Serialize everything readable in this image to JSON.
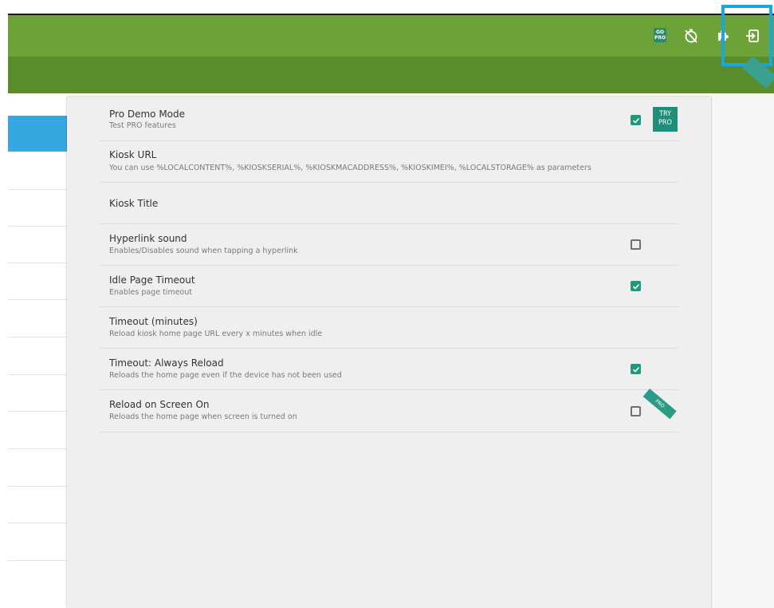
{
  "toolbar": {
    "gopro_icon": "go-pro-icon",
    "gopro_top": "GO",
    "gopro_bottom": "PRO",
    "timer_icon": "timer-off-icon",
    "extension_icon": "puzzle-icon",
    "exit_icon": "exit-icon",
    "bg": "#6da238",
    "subbar_bg": "#588c2d"
  },
  "settings": [
    {
      "title": "Pro Demo Mode",
      "subtitle": "Test PRO features",
      "checkbox": true,
      "try_pro": "TRY PRO"
    },
    {
      "title": "Kiosk URL",
      "subtitle": "You can use %LOCALCONTENT%, %KIOSKSERIAL%, %KIOSKMACADDRESS%, %KIOSKIMEI%, %LOCALSTORAGE% as parameters"
    },
    {
      "title": "Kiosk Title"
    },
    {
      "title": "Hyperlink sound",
      "subtitle": "Enables/Disables sound when tapping a hyperlink",
      "checkbox": false
    },
    {
      "title": "Idle Page Timeout",
      "subtitle": "Enables page timeout",
      "checkbox": true
    },
    {
      "title": "Timeout (minutes)",
      "subtitle": "Reload kiosk home page URL every x minutes when idle"
    },
    {
      "title": "Timeout: Always Reload",
      "subtitle": "Reloads the home page even if the device has not been used",
      "checkbox": true
    },
    {
      "title": "Reload on Screen On",
      "subtitle": "Reloads the home page when screen is turned on",
      "checkbox": false,
      "pro_badge": "PRO"
    }
  ],
  "try_pro": {
    "line1": "TRY",
    "line2": "PRO"
  },
  "colors": {
    "accent": "#26957d",
    "sidebar_active": "#37a8df",
    "highlight": "#1aa6e0"
  }
}
